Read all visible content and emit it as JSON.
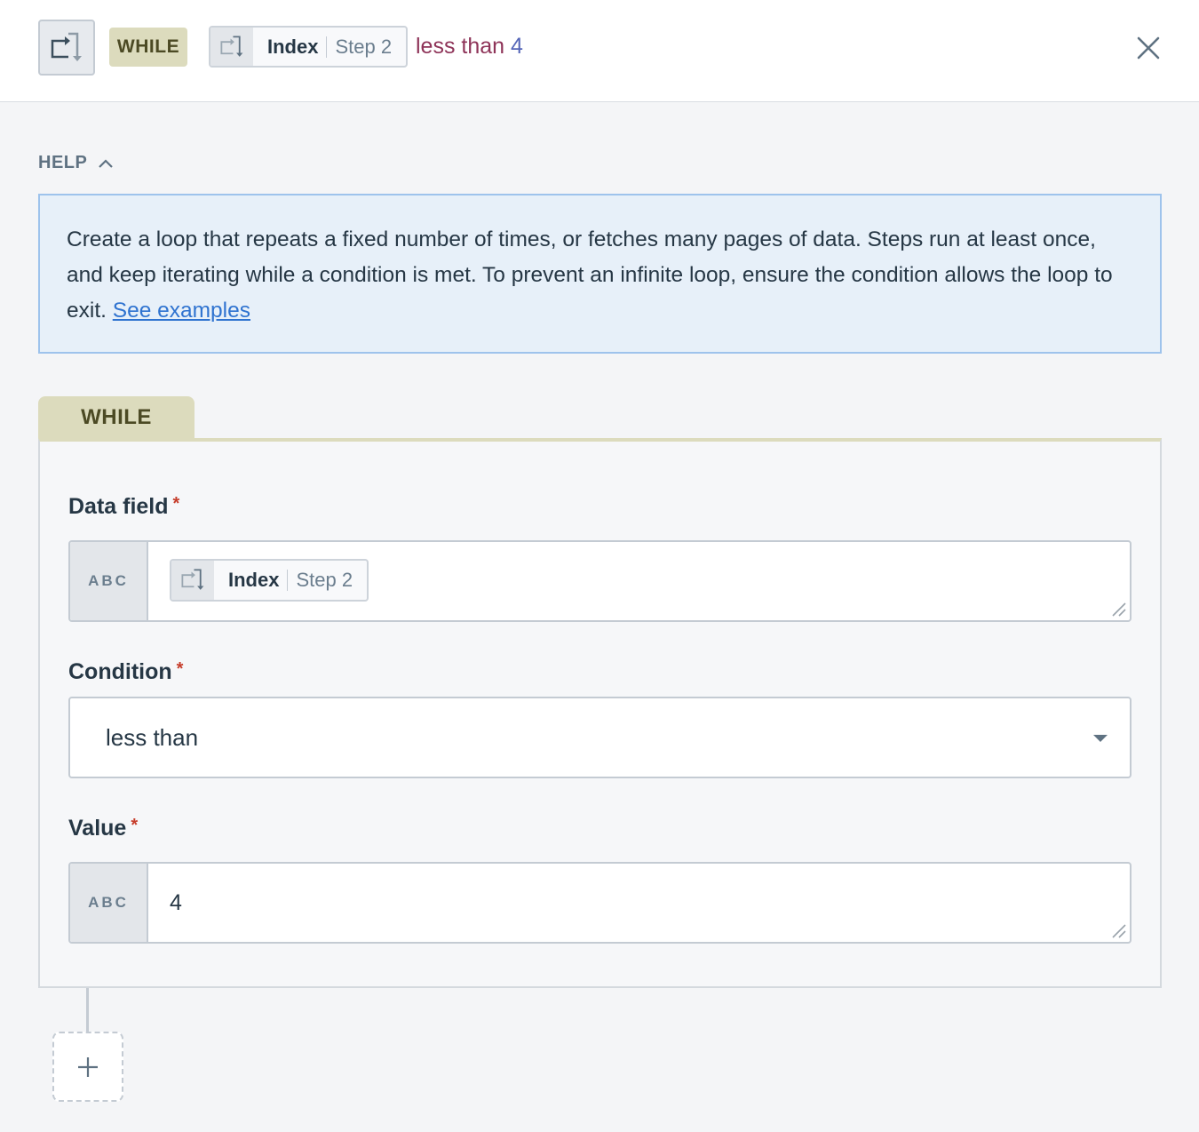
{
  "header": {
    "step_type_badge": "WHILE",
    "reference": {
      "name": "Index",
      "step": "Step 2"
    },
    "summary": {
      "operator": "less than",
      "value": "4"
    },
    "icons": {
      "step": "loop-icon",
      "close": "close-icon"
    }
  },
  "help": {
    "toggle_label": "HELP",
    "expanded": true,
    "text": "Create a loop that repeats a fixed number of times, or fetches many pages of data. Steps run at least once, and keep iterating while a condition is met. To prevent an infinite loop, ensure the condition allows the loop to exit. ",
    "link_label": "See examples"
  },
  "condition_block": {
    "tab_label": "WHILE",
    "fields": {
      "data_field": {
        "label": "Data field",
        "required": "*",
        "type_badge": "ABC",
        "reference": {
          "name": "Index",
          "step": "Step 2"
        }
      },
      "condition": {
        "label": "Condition",
        "required": "*",
        "selected": "less than"
      },
      "value": {
        "label": "Value",
        "required": "*",
        "type_badge": "ABC",
        "value": "4"
      }
    }
  },
  "add_step": {
    "icon": "plus-icon"
  },
  "colors": {
    "while_badge_bg": "#dcdbbd",
    "while_badge_text": "#4c4a24",
    "operator_text": "#8e3358",
    "value_text": "#5566b8",
    "link": "#2f73d0",
    "required_asterisk": "#c63d2b",
    "help_bg": "#e7f0f9",
    "help_border": "#9ec3ec"
  }
}
